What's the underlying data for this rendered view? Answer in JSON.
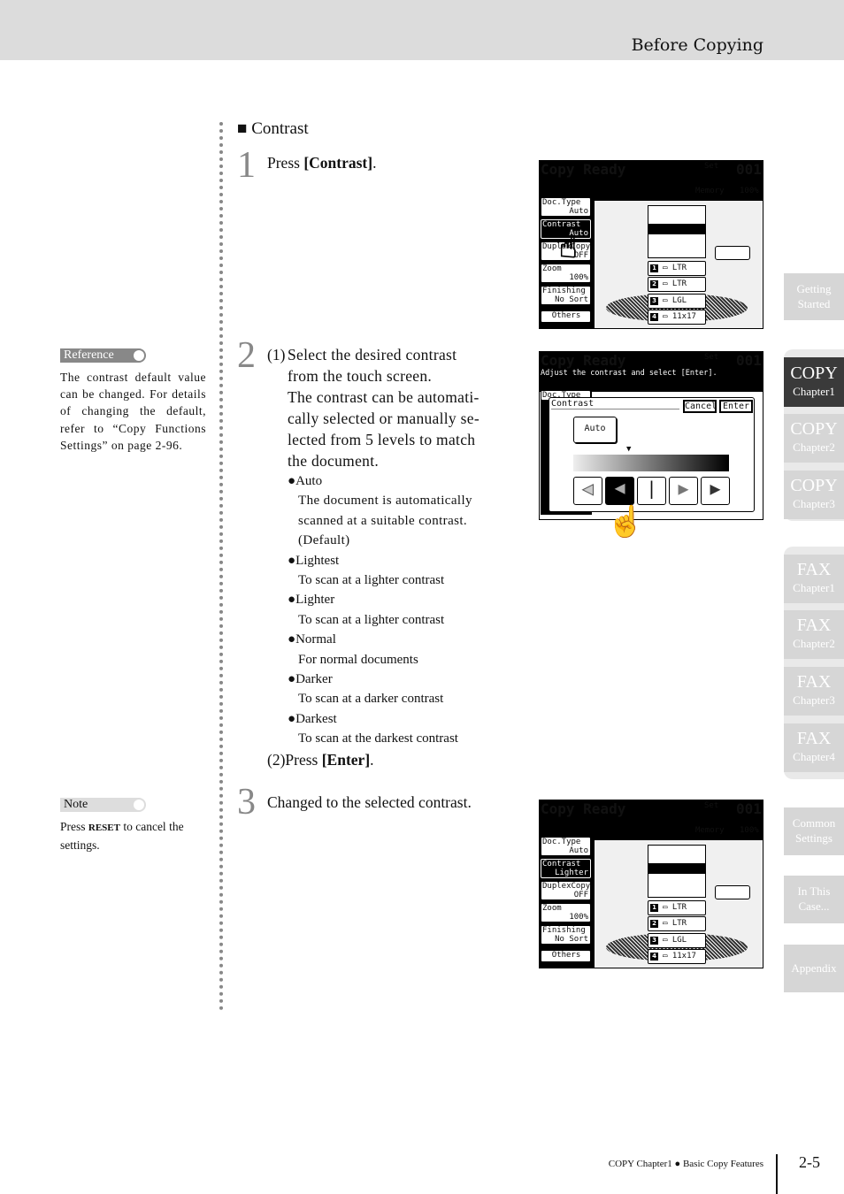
{
  "header": {
    "title": "Before Copying"
  },
  "section": {
    "title": "Contrast",
    "marker": "■"
  },
  "steps": [
    {
      "num": "1",
      "text_pre": "Press ",
      "text_bold": "[Contrast]",
      "text_post": "."
    },
    {
      "num": "2",
      "sub1_label": "(1)",
      "sub1_lines": [
        "Select the desired contrast",
        "from the touch screen.",
        "The contrast can be automati-",
        "cally selected or manually se-",
        "lected from 5 levels to match",
        "the document."
      ],
      "options": [
        {
          "name": "Auto",
          "desc": [
            "The document is automatically",
            "scanned at a suitable contrast.",
            "(Default)"
          ]
        },
        {
          "name": "Lightest",
          "desc": [
            "To scan at a lighter contrast"
          ]
        },
        {
          "name": "Lighter",
          "desc": [
            "To scan at a lighter contrast"
          ]
        },
        {
          "name": "Normal",
          "desc": [
            "For normal documents"
          ]
        },
        {
          "name": "Darker",
          "desc": [
            "To scan at a darker contrast"
          ]
        },
        {
          "name": "Darkest",
          "desc": [
            "To scan at the darkest contrast"
          ]
        }
      ],
      "sub2_label": "(2)",
      "sub2_pre": "Press ",
      "sub2_bold": "[Enter]",
      "sub2_post": "."
    },
    {
      "num": "3",
      "text": "Changed to the selected contrast."
    }
  ],
  "reference": {
    "label": "Reference",
    "text": "The contrast default value can be changed. For details of changing the default, refer to “Copy Functions Settings” on page 2-96."
  },
  "note": {
    "label": "Note",
    "pre": "Press ",
    "bold": "RESET",
    "post": " to cancel the settings."
  },
  "screens": [
    {
      "title": "Copy Ready",
      "set": "Set",
      "count": "001",
      "memory": "Memory",
      "memory_pct": "100%",
      "buttons": [
        {
          "l": "Doc.Type",
          "v": "Auto"
        },
        {
          "l": "Contrast",
          "v": "Auto"
        },
        {
          "l": "DuplexCopy",
          "v": "OFF"
        },
        {
          "l": "Zoom",
          "v": "100%"
        },
        {
          "l": "Finishing",
          "v": "No Sort"
        }
      ],
      "others": "Others",
      "trays": [
        {
          "n": "1",
          "s": "LTR"
        },
        {
          "n": "2",
          "s": "LTR"
        },
        {
          "n": "3",
          "s": "LGL"
        },
        {
          "n": "4",
          "s": "11x17"
        }
      ]
    },
    {
      "title": "Copy Ready",
      "set": "Set",
      "count": "001",
      "message": "Adjust the contrast and select [Enter].",
      "dialog_title": "Contrast",
      "cancel": "Cancel",
      "enter": "Enter",
      "auto": "Auto",
      "bg_button": "Doc.Type"
    },
    {
      "title": "Copy Ready",
      "set": "Set",
      "count": "001",
      "memory": "Memory",
      "memory_pct": "100%",
      "buttons": [
        {
          "l": "Doc.Type",
          "v": "Auto"
        },
        {
          "l": "Contrast",
          "v": "Lighter"
        },
        {
          "l": "DuplexCopy",
          "v": "OFF"
        },
        {
          "l": "Zoom",
          "v": "100%"
        },
        {
          "l": "Finishing",
          "v": "No Sort"
        }
      ],
      "others": "Others",
      "trays": [
        {
          "n": "1",
          "s": "LTR"
        },
        {
          "n": "2",
          "s": "LTR"
        },
        {
          "n": "3",
          "s": "LGL"
        },
        {
          "n": "4",
          "s": "11x17"
        }
      ]
    }
  ],
  "side_tabs": [
    {
      "a": "Getting",
      "b": "Started"
    },
    {
      "a": "COPY",
      "b": "Chapter1",
      "active": true
    },
    {
      "a": "COPY",
      "b": "Chapter2"
    },
    {
      "a": "COPY",
      "b": "Chapter3"
    },
    {
      "a": "FAX",
      "b": "Chapter1"
    },
    {
      "a": "FAX",
      "b": "Chapter2"
    },
    {
      "a": "FAX",
      "b": "Chapter3"
    },
    {
      "a": "FAX",
      "b": "Chapter4"
    },
    {
      "a": "Common",
      "b": "Settings"
    },
    {
      "a": "In This",
      "b": "Case..."
    },
    {
      "a": "Appendix",
      "b": ""
    }
  ],
  "footer": {
    "chapter": "COPY Chapter1",
    "bullet": "●",
    "section": "Basic Copy Features",
    "page": "2-5"
  },
  "colors": {
    "header_bg": "#dcdcdc",
    "tab_bg": "#d6d6d6",
    "tab_active": "#3a3a3a",
    "reference_badge": "#888888",
    "note_badge": "#dddddd"
  }
}
